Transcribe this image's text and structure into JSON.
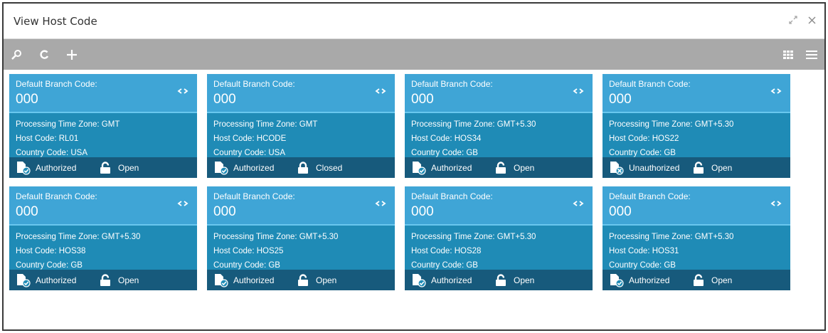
{
  "window": {
    "title": "View Host Code"
  },
  "icons": {
    "minimize": "minimize-arrows-icon",
    "close": "close-icon",
    "search": "search-icon",
    "refresh": "refresh-icon",
    "add": "plus-icon",
    "tile_view": "grid-view-icon",
    "list_view": "list-view-icon"
  },
  "colors": {
    "toolbar": "#a9a9a9",
    "card_head": "#3fa5d6",
    "card_body": "#1f8bb6",
    "card_foot": "#175a7c"
  },
  "cards": [
    {
      "branch_label": "Default Branch Code:",
      "branch_code": "000",
      "tz": "Processing Time Zone: GMT",
      "host": "Host Code: RL01",
      "country": "Country Code: USA",
      "auth": "Authorized",
      "lock": "Open"
    },
    {
      "branch_label": "Default Branch Code:",
      "branch_code": "000",
      "tz": "Processing Time Zone: GMT",
      "host": "Host Code: HCODE",
      "country": "Country Code: USA",
      "auth": "Authorized",
      "lock": "Closed"
    },
    {
      "branch_label": "Default Branch Code:",
      "branch_code": "000",
      "tz": "Processing Time Zone: GMT+5.30",
      "host": "Host Code: HOS34",
      "country": "Country Code: GB",
      "auth": "Authorized",
      "lock": "Open"
    },
    {
      "branch_label": "Default Branch Code:",
      "branch_code": "000",
      "tz": "Processing Time Zone: GMT+5.30",
      "host": "Host Code: HOS22",
      "country": "Country Code: GB",
      "auth": "Unauthorized",
      "lock": "Open"
    },
    {
      "branch_label": "Default Branch Code:",
      "branch_code": "000",
      "tz": "Processing Time Zone: GMT+5.30",
      "host": "Host Code: HOS38",
      "country": "Country Code: GB",
      "auth": "Authorized",
      "lock": "Open"
    },
    {
      "branch_label": "Default Branch Code:",
      "branch_code": "000",
      "tz": "Processing Time Zone: GMT+5.30",
      "host": "Host Code: HOS25",
      "country": "Country Code: GB",
      "auth": "Authorized",
      "lock": "Open"
    },
    {
      "branch_label": "Default Branch Code:",
      "branch_code": "000",
      "tz": "Processing Time Zone: GMT+5.30",
      "host": "Host Code: HOS28",
      "country": "Country Code: GB",
      "auth": "Authorized",
      "lock": "Open"
    },
    {
      "branch_label": "Default Branch Code:",
      "branch_code": "000",
      "tz": "Processing Time Zone: GMT+5.30",
      "host": "Host Code: HOS31",
      "country": "Country Code: GB",
      "auth": "Authorized",
      "lock": "Open"
    }
  ]
}
